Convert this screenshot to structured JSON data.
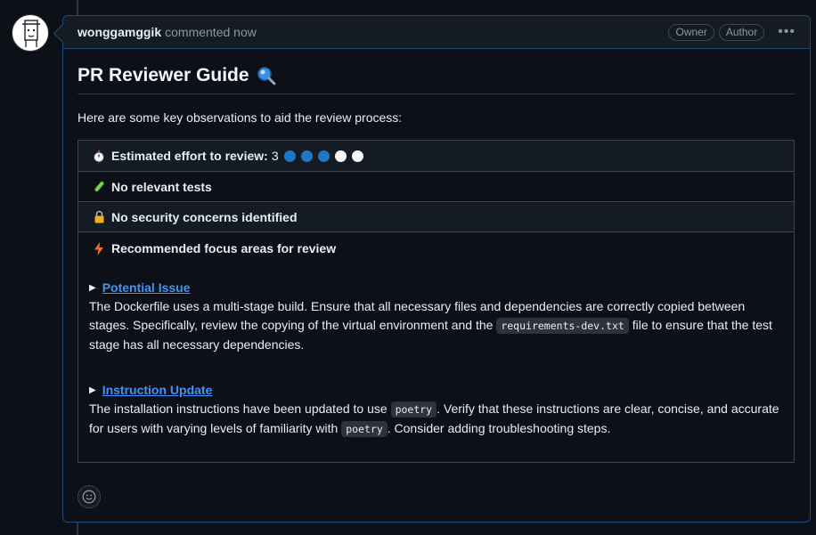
{
  "comment": {
    "author": "wonggamggik",
    "meta": "commented now",
    "badges": [
      "Owner",
      "Author"
    ],
    "more_icon": "kebab-horizontal-icon"
  },
  "body": {
    "title": "PR Reviewer Guide",
    "title_icon": "magnifying-glass-icon",
    "intro": "Here are some key observations to aid the review process:",
    "effort": {
      "icon": "stopwatch-icon",
      "label": "Estimated effort to review:",
      "value": "3",
      "max": 5,
      "filled_color": "#1f76c4",
      "empty_color": "#f5f5f5"
    },
    "tests": {
      "icon": "test-tube-icon",
      "label": "No relevant tests"
    },
    "security": {
      "icon": "lock-icon",
      "label": "No security concerns identified"
    },
    "focus": {
      "icon": "zap-icon",
      "label": "Recommended focus areas for review",
      "issues": [
        {
          "title": "Potential Issue",
          "text_1": "The Dockerfile uses a multi-stage build. Ensure that all necessary files and dependencies are correctly copied between stages. Specifically, review the copying of the virtual environment and the",
          "code_1": "requirements-dev.txt",
          "text_2": "file to ensure that the test stage has all necessary dependencies."
        },
        {
          "title": "Instruction Update",
          "text_1": "The installation instructions have been updated to use",
          "code_1": "poetry",
          "text_2": ". Verify that these instructions are clear, concise, and accurate for users with varying levels of familiarity with",
          "code_2": "poetry",
          "text_3": ". Consider adding troubleshooting steps."
        }
      ]
    }
  },
  "reaction_icon": "smiley-icon",
  "colors": {
    "link": "#4493f8",
    "accent_border": "#1f4a7a",
    "background": "#0d1117"
  }
}
